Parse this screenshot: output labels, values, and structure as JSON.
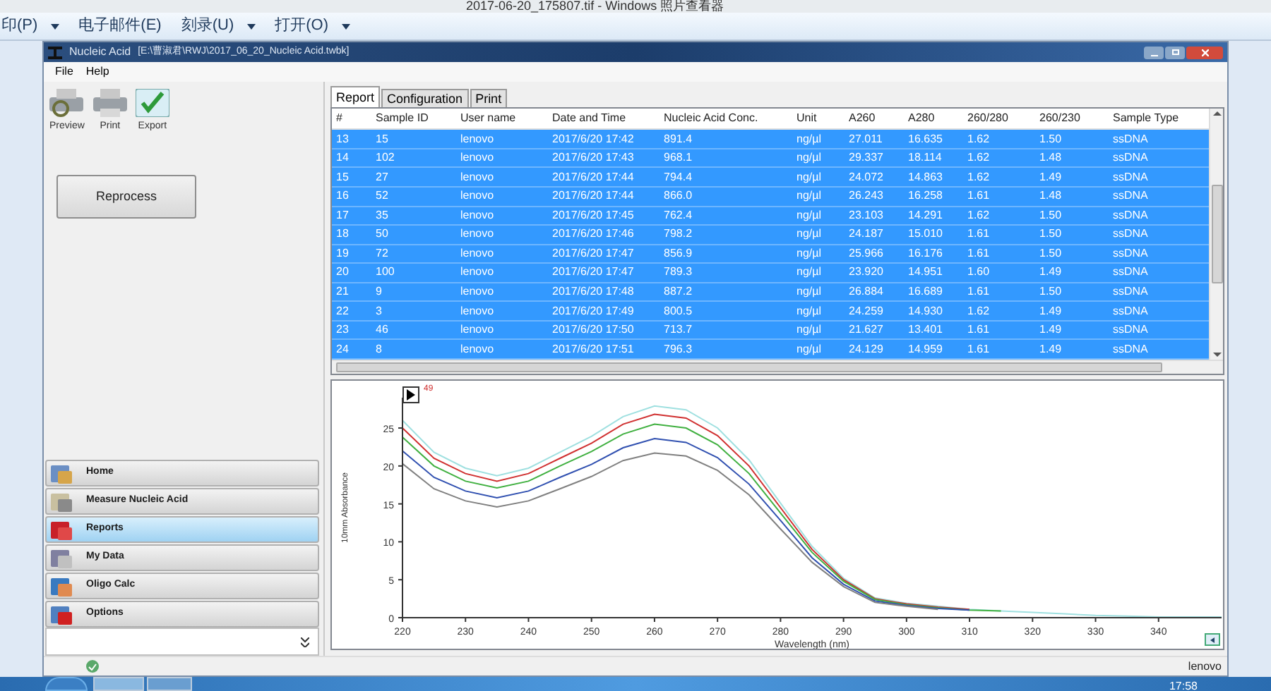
{
  "viewer": {
    "title": "2017-06-20_175807.tif - Windows 照片查看器",
    "menu": [
      {
        "label": "印(P)",
        "dropdown": true
      },
      {
        "label": "电子邮件(E)",
        "dropdown": false
      },
      {
        "label": "刻录(U)",
        "dropdown": true
      },
      {
        "label": "打开(O)",
        "dropdown": true
      }
    ]
  },
  "window": {
    "title": "Nucleic Acid",
    "path": "[E:\\曹淑君\\RWJ\\2017_06_20_Nucleic Acid.twbk]"
  },
  "menubar": [
    "File",
    "Help"
  ],
  "toolbar": [
    {
      "label": "Preview",
      "kind": "preview"
    },
    {
      "label": "Print",
      "kind": "print"
    },
    {
      "label": "Export",
      "kind": "export"
    }
  ],
  "reprocess_button": "Reprocess",
  "nav": [
    {
      "label": "Home",
      "kind": "home",
      "selected": false
    },
    {
      "label": "Measure Nucleic Acid",
      "kind": "measure",
      "selected": false
    },
    {
      "label": "Reports",
      "kind": "reports",
      "selected": true
    },
    {
      "label": "My Data",
      "kind": "data",
      "selected": false
    },
    {
      "label": "Oligo Calc",
      "kind": "calc",
      "selected": false
    },
    {
      "label": "Options",
      "kind": "options",
      "selected": false
    }
  ],
  "tabs": [
    {
      "label": "Report",
      "selected": true
    },
    {
      "label": "Configuration",
      "selected": false
    },
    {
      "label": "Print",
      "selected": false
    }
  ],
  "table": {
    "columns": [
      "#",
      "Sample ID",
      "User name",
      "Date and Time",
      "Nucleic Acid Conc.",
      "Unit",
      "A260",
      "A280",
      "260/280",
      "260/230",
      "Sample Type"
    ],
    "rows": [
      {
        "selected": true,
        "cells": [
          "13",
          "15",
          "lenovo",
          "2017/6/20 17:42",
          "891.4",
          "ng/µl",
          "27.011",
          "16.635",
          "1.62",
          "1.50",
          "ssDNA"
        ]
      },
      {
        "selected": true,
        "cells": [
          "14",
          "102",
          "lenovo",
          "2017/6/20 17:43",
          "968.1",
          "ng/µl",
          "29.337",
          "18.114",
          "1.62",
          "1.48",
          "ssDNA"
        ]
      },
      {
        "selected": true,
        "cells": [
          "15",
          "27",
          "lenovo",
          "2017/6/20 17:44",
          "794.4",
          "ng/µl",
          "24.072",
          "14.863",
          "1.62",
          "1.49",
          "ssDNA"
        ]
      },
      {
        "selected": true,
        "cells": [
          "16",
          "52",
          "lenovo",
          "2017/6/20 17:44",
          "866.0",
          "ng/µl",
          "26.243",
          "16.258",
          "1.61",
          "1.48",
          "ssDNA"
        ]
      },
      {
        "selected": true,
        "cells": [
          "17",
          "35",
          "lenovo",
          "2017/6/20 17:45",
          "762.4",
          "ng/µl",
          "23.103",
          "14.291",
          "1.62",
          "1.50",
          "ssDNA"
        ]
      },
      {
        "selected": true,
        "cells": [
          "18",
          "50",
          "lenovo",
          "2017/6/20 17:46",
          "798.2",
          "ng/µl",
          "24.187",
          "15.010",
          "1.61",
          "1.50",
          "ssDNA"
        ]
      },
      {
        "selected": true,
        "cells": [
          "19",
          "72",
          "lenovo",
          "2017/6/20 17:47",
          "856.9",
          "ng/µl",
          "25.966",
          "16.176",
          "1.61",
          "1.50",
          "ssDNA"
        ]
      },
      {
        "selected": true,
        "cells": [
          "20",
          "100",
          "lenovo",
          "2017/6/20 17:47",
          "789.3",
          "ng/µl",
          "23.920",
          "14.951",
          "1.60",
          "1.49",
          "ssDNA"
        ]
      },
      {
        "selected": true,
        "cells": [
          "21",
          "9",
          "lenovo",
          "2017/6/20 17:48",
          "887.2",
          "ng/µl",
          "26.884",
          "16.689",
          "1.61",
          "1.50",
          "ssDNA"
        ]
      },
      {
        "selected": true,
        "cells": [
          "22",
          "3",
          "lenovo",
          "2017/6/20 17:49",
          "800.5",
          "ng/µl",
          "24.259",
          "14.930",
          "1.62",
          "1.49",
          "ssDNA"
        ]
      },
      {
        "selected": true,
        "cells": [
          "23",
          "46",
          "lenovo",
          "2017/6/20 17:50",
          "713.7",
          "ng/µl",
          "21.627",
          "13.401",
          "1.61",
          "1.49",
          "ssDNA"
        ]
      },
      {
        "selected": true,
        "cells": [
          "24",
          "8",
          "lenovo",
          "2017/6/20 17:51",
          "796.3",
          "ng/µl",
          "24.129",
          "14.959",
          "1.61",
          "1.49",
          "ssDNA"
        ]
      }
    ]
  },
  "chart": {
    "marker": "49",
    "chart_data": {
      "type": "line",
      "xlabel": "Wavelength (nm)",
      "ylabel": "10mm Absorbance",
      "x": [
        220,
        225,
        230,
        235,
        240,
        245,
        250,
        255,
        260,
        265,
        270,
        275,
        280,
        285,
        290,
        295,
        300,
        305,
        310,
        315,
        320,
        325,
        330,
        335,
        340,
        345,
        350
      ],
      "xlim": [
        220,
        350
      ],
      "ylim": [
        0,
        29
      ],
      "xticks": [
        220,
        230,
        240,
        250,
        260,
        270,
        280,
        290,
        300,
        310,
        320,
        330,
        340
      ],
      "yticks": [
        0,
        5,
        10,
        15,
        20,
        25
      ],
      "series": [
        {
          "color": "#9fe0e0",
          "values": [
            26,
            21.8,
            19.7,
            18.7,
            19.7,
            21.8,
            23.9,
            26.5,
            27.9,
            27.4,
            25,
            20.8,
            15.1,
            9.4,
            5.2,
            2.6,
            1.9,
            1.5,
            1.1,
            0.9,
            0.7,
            0.5,
            0.3,
            0.2,
            0.1,
            0.1,
            0.1
          ]
        },
        {
          "color": "#d03030",
          "values": [
            25,
            21,
            19,
            18,
            19,
            21,
            23,
            25.5,
            26.8,
            26.3,
            24,
            20,
            14.5,
            9,
            5,
            2.5,
            1.8,
            1.4,
            1.1,
            null,
            null,
            null,
            null,
            null,
            null,
            null,
            null
          ]
        },
        {
          "color": "#40b040",
          "values": [
            23.8,
            20,
            18,
            17.1,
            18,
            20,
            21.9,
            24.2,
            25.5,
            25,
            22.8,
            19,
            13.8,
            8.6,
            4.8,
            2.4,
            1.7,
            1.3,
            1,
            0.9,
            null,
            null,
            null,
            null,
            null,
            null,
            null
          ]
        },
        {
          "color": "#3050b0",
          "values": [
            22,
            18.5,
            16.7,
            15.8,
            16.7,
            18.5,
            20.2,
            22.4,
            23.6,
            23.1,
            21.1,
            17.6,
            12.8,
            7.9,
            4.4,
            2.2,
            1.6,
            1.2,
            1,
            null,
            null,
            null,
            null,
            null,
            null,
            null,
            null
          ]
        },
        {
          "color": "#808080",
          "values": [
            20.3,
            17,
            15.4,
            14.6,
            15.4,
            17,
            18.6,
            20.7,
            21.7,
            21.3,
            19.4,
            16.2,
            11.7,
            7.3,
            4.1,
            2,
            1.5,
            1.1,
            null,
            null,
            null,
            null,
            null,
            null,
            null,
            null,
            null
          ]
        }
      ]
    }
  },
  "status_bar": "lenovo",
  "taskbar": {
    "time": "17:58"
  }
}
